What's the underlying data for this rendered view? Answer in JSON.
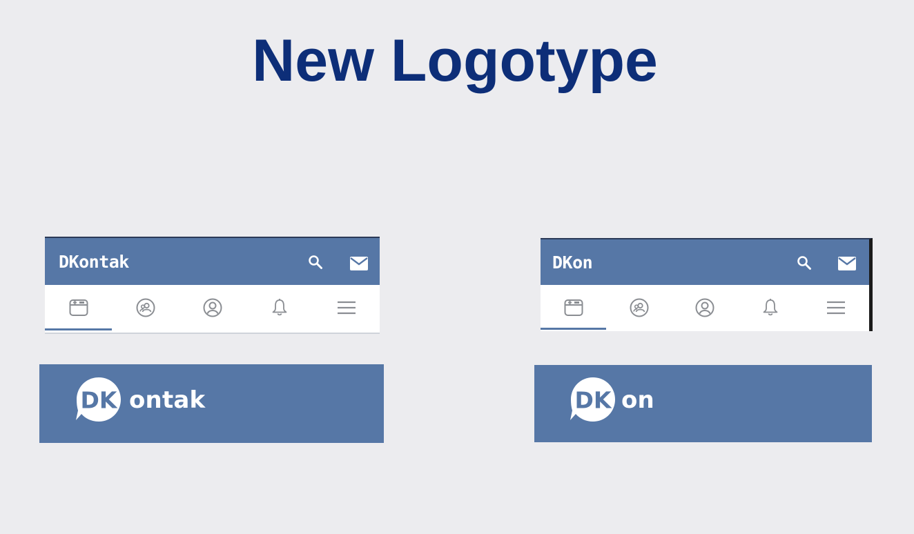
{
  "slide": {
    "title": "New Logotype"
  },
  "colors": {
    "background": "#ececef",
    "title": "#0d2e78",
    "brand_blue": "#5677a6",
    "tab_bar": "#ffffff",
    "icon_gray": "#8a8d92"
  },
  "headers": [
    {
      "brand": "DKontak",
      "actions": [
        "search-icon",
        "mail-icon"
      ],
      "tabs": [
        "news-icon",
        "friends-icon",
        "profile-icon",
        "bell-icon",
        "menu-icon"
      ],
      "active_tab": 0
    },
    {
      "brand": "DKon",
      "actions": [
        "search-icon",
        "mail-icon"
      ],
      "tabs": [
        "news-icon",
        "friends-icon",
        "profile-icon",
        "bell-icon",
        "menu-icon"
      ],
      "active_tab": 0
    }
  ],
  "logos": [
    {
      "mark": "DK",
      "wordmark": "ontak"
    },
    {
      "mark": "DK",
      "wordmark": "on"
    }
  ]
}
